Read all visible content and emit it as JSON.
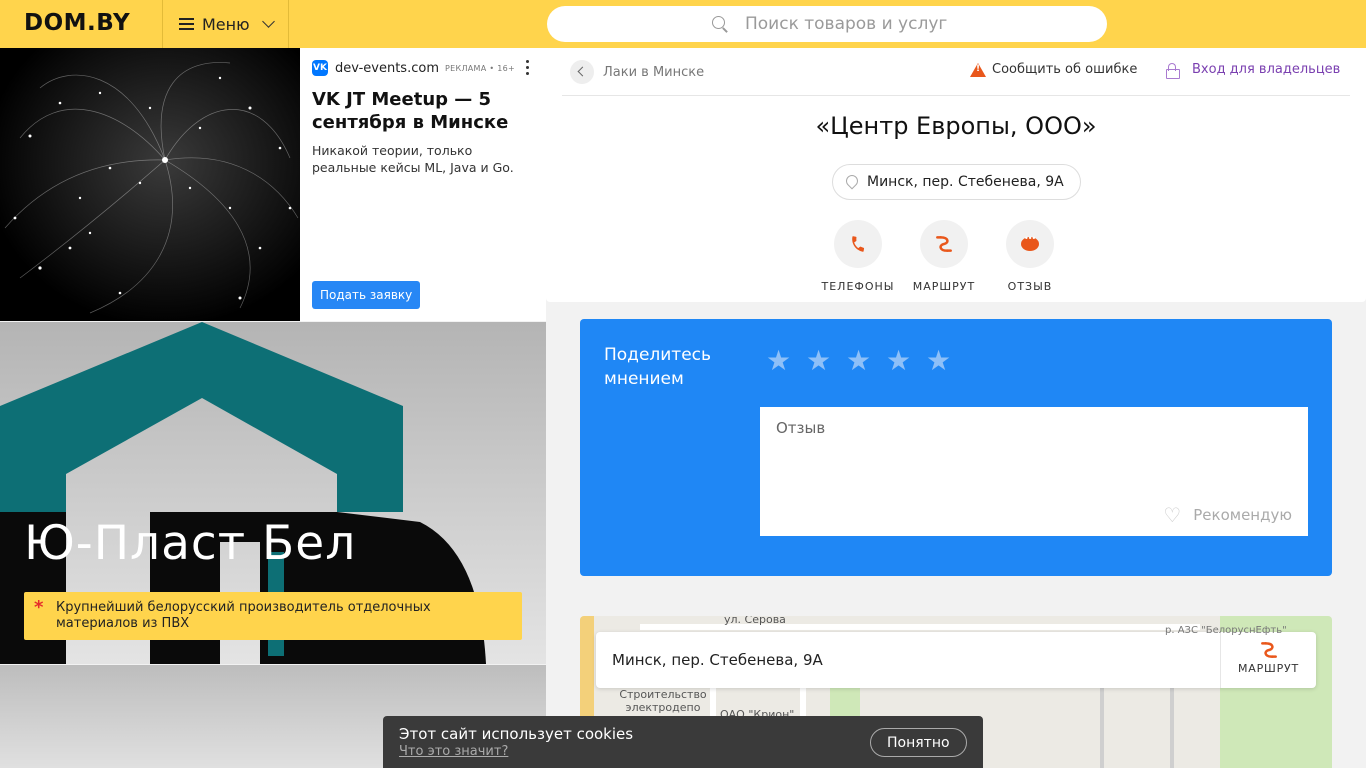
{
  "header": {
    "logo": "DOM.BY",
    "menu_label": "Меню",
    "search_placeholder": "Поиск товаров и услуг"
  },
  "ad_top": {
    "source": "dev-events.com",
    "tag": "РЕКЛАМА • 16+",
    "title": "VK JT Meetup — 5 сентября в Минске",
    "description": "Никакой теории, только реальные кейсы ML, Java и Go.",
    "button": "Подать заявку"
  },
  "ad_mid": {
    "title": "Ю-Пласт Бел",
    "note": "Крупнейший белорусский производитель отделочных материалов из ПВХ"
  },
  "card": {
    "breadcrumb": "Лаки в Минске",
    "report_label": "Сообщить об ошибке",
    "owner_label": "Вход для владельцев",
    "title": "«Центр Европы, ООО»",
    "address": "Минск, пер. Стебенева, 9А",
    "actions": [
      {
        "label": "ТЕЛЕФОНЫ",
        "icon": "phone-icon"
      },
      {
        "label": "МАРШРУТ",
        "icon": "route-icon"
      },
      {
        "label": "ОТЗЫВ",
        "icon": "comment-icon"
      }
    ]
  },
  "review": {
    "title": "Поделитесь мнением",
    "stars": 5,
    "placeholder": "Отзыв",
    "recommend": "Рекомендую"
  },
  "map": {
    "address": "Минск, пер. Стебенева, 9А",
    "route_label": "МАРШРУТ",
    "labels": [
      "ул. Серова",
      "Строительство электродепо",
      "ОАО \"Крион\"",
      "р. АЗС \"БелоруснЕфть\""
    ]
  },
  "cookie": {
    "message": "Этот сайт использует cookies",
    "link": "Что это значит?",
    "button": "Понятно"
  },
  "colors": {
    "header": "#ffd44c",
    "accent_orange": "#e9571b",
    "review_blue": "#1f87f5",
    "vk_blue": "#2787f5"
  }
}
